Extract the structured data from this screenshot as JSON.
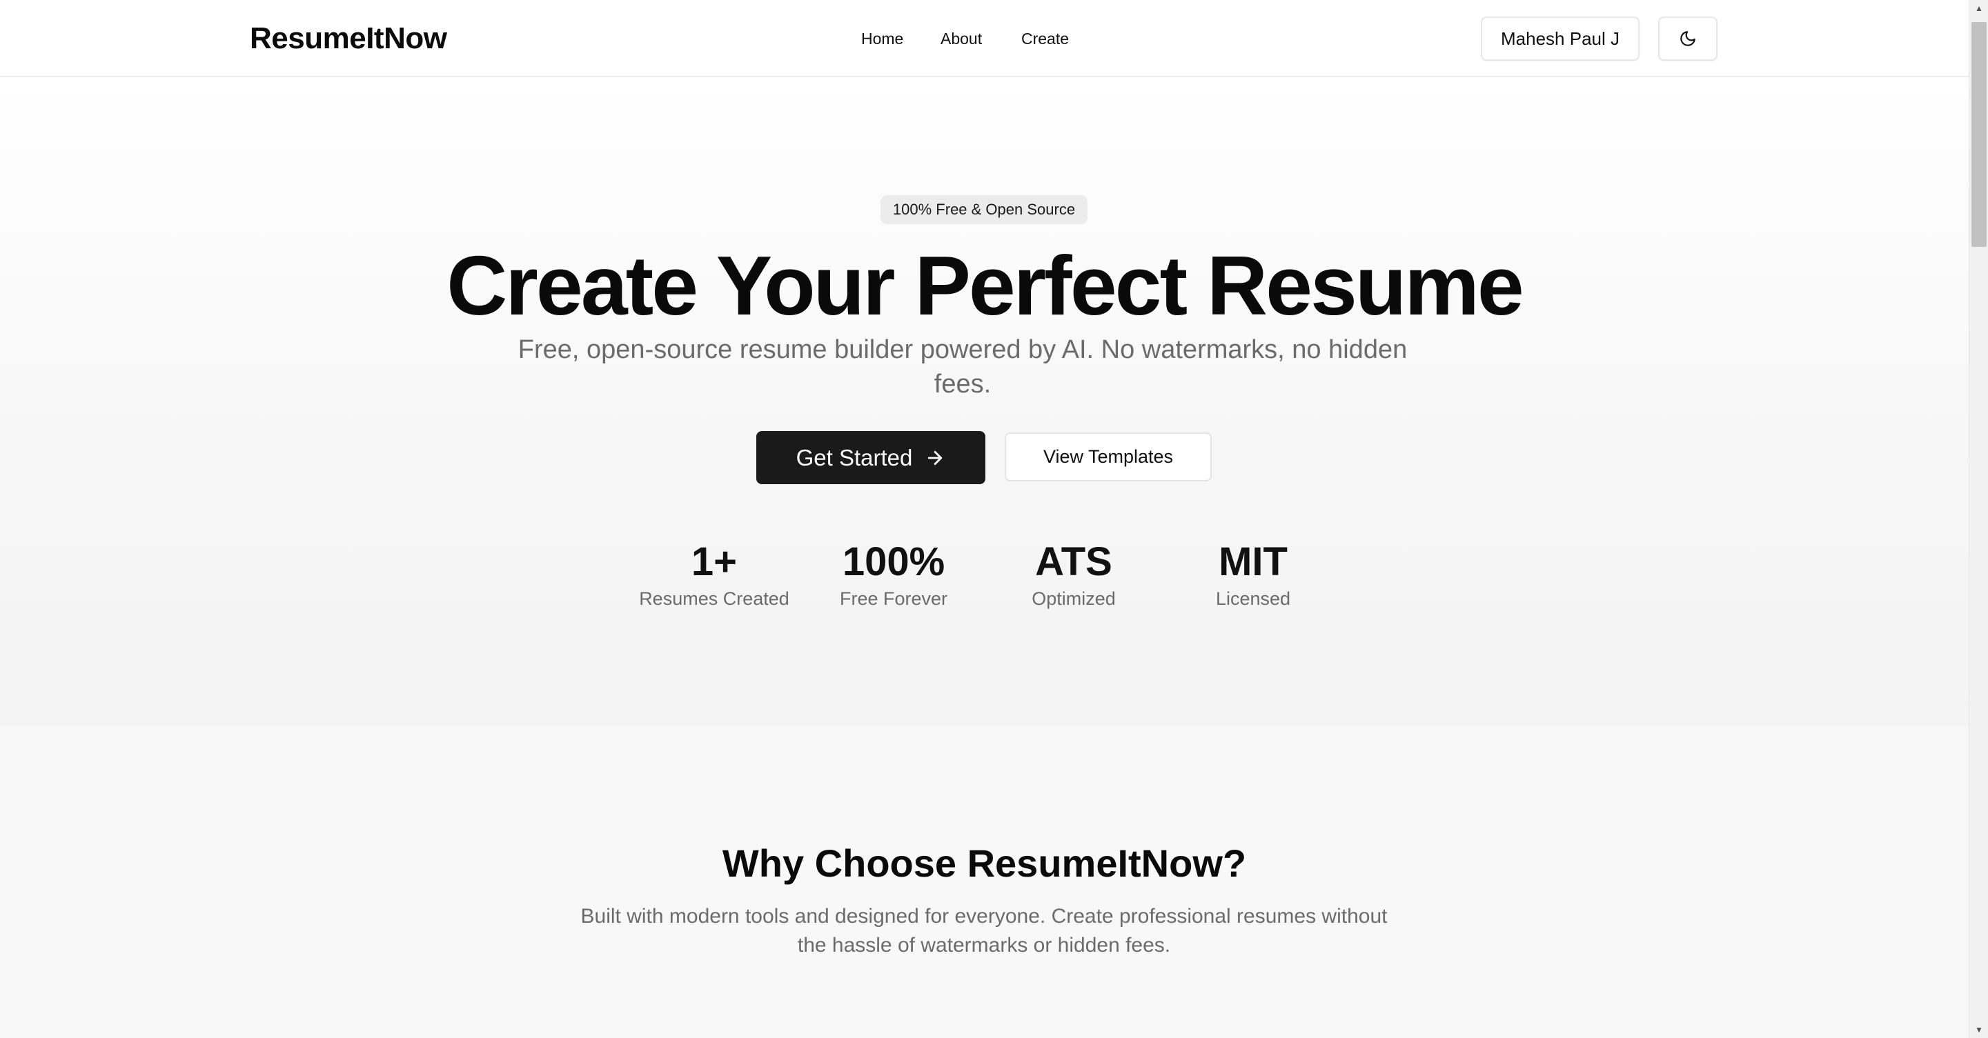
{
  "header": {
    "brand": "ResumeItNow",
    "nav": [
      "Home",
      "About",
      "Create"
    ],
    "user_name": "Mahesh Paul J",
    "theme_toggle_icon": "moon-icon"
  },
  "hero": {
    "badge": "100% Free & Open Source",
    "title": "Create Your Perfect Resume",
    "subtitle": "Free, open-source resume builder powered by AI. No watermarks, no hidden fees.",
    "primary_button": "Get Started",
    "primary_button_icon": "arrow-right-icon",
    "secondary_button": "View Templates",
    "stats": [
      {
        "value": "1+",
        "label": "Resumes Created"
      },
      {
        "value": "100%",
        "label": "Free Forever"
      },
      {
        "value": "ATS",
        "label": "Optimized"
      },
      {
        "value": "MIT",
        "label": "Licensed"
      }
    ]
  },
  "features": {
    "title": "Why Choose ResumeItNow?",
    "subtitle": "Built with modern tools and designed for everyone. Create professional resumes without the hassle of watermarks or hidden fees."
  },
  "colors": {
    "primary": "#1a1a1a",
    "muted_text": "#6b6b6b",
    "border": "#e6e6e6"
  }
}
